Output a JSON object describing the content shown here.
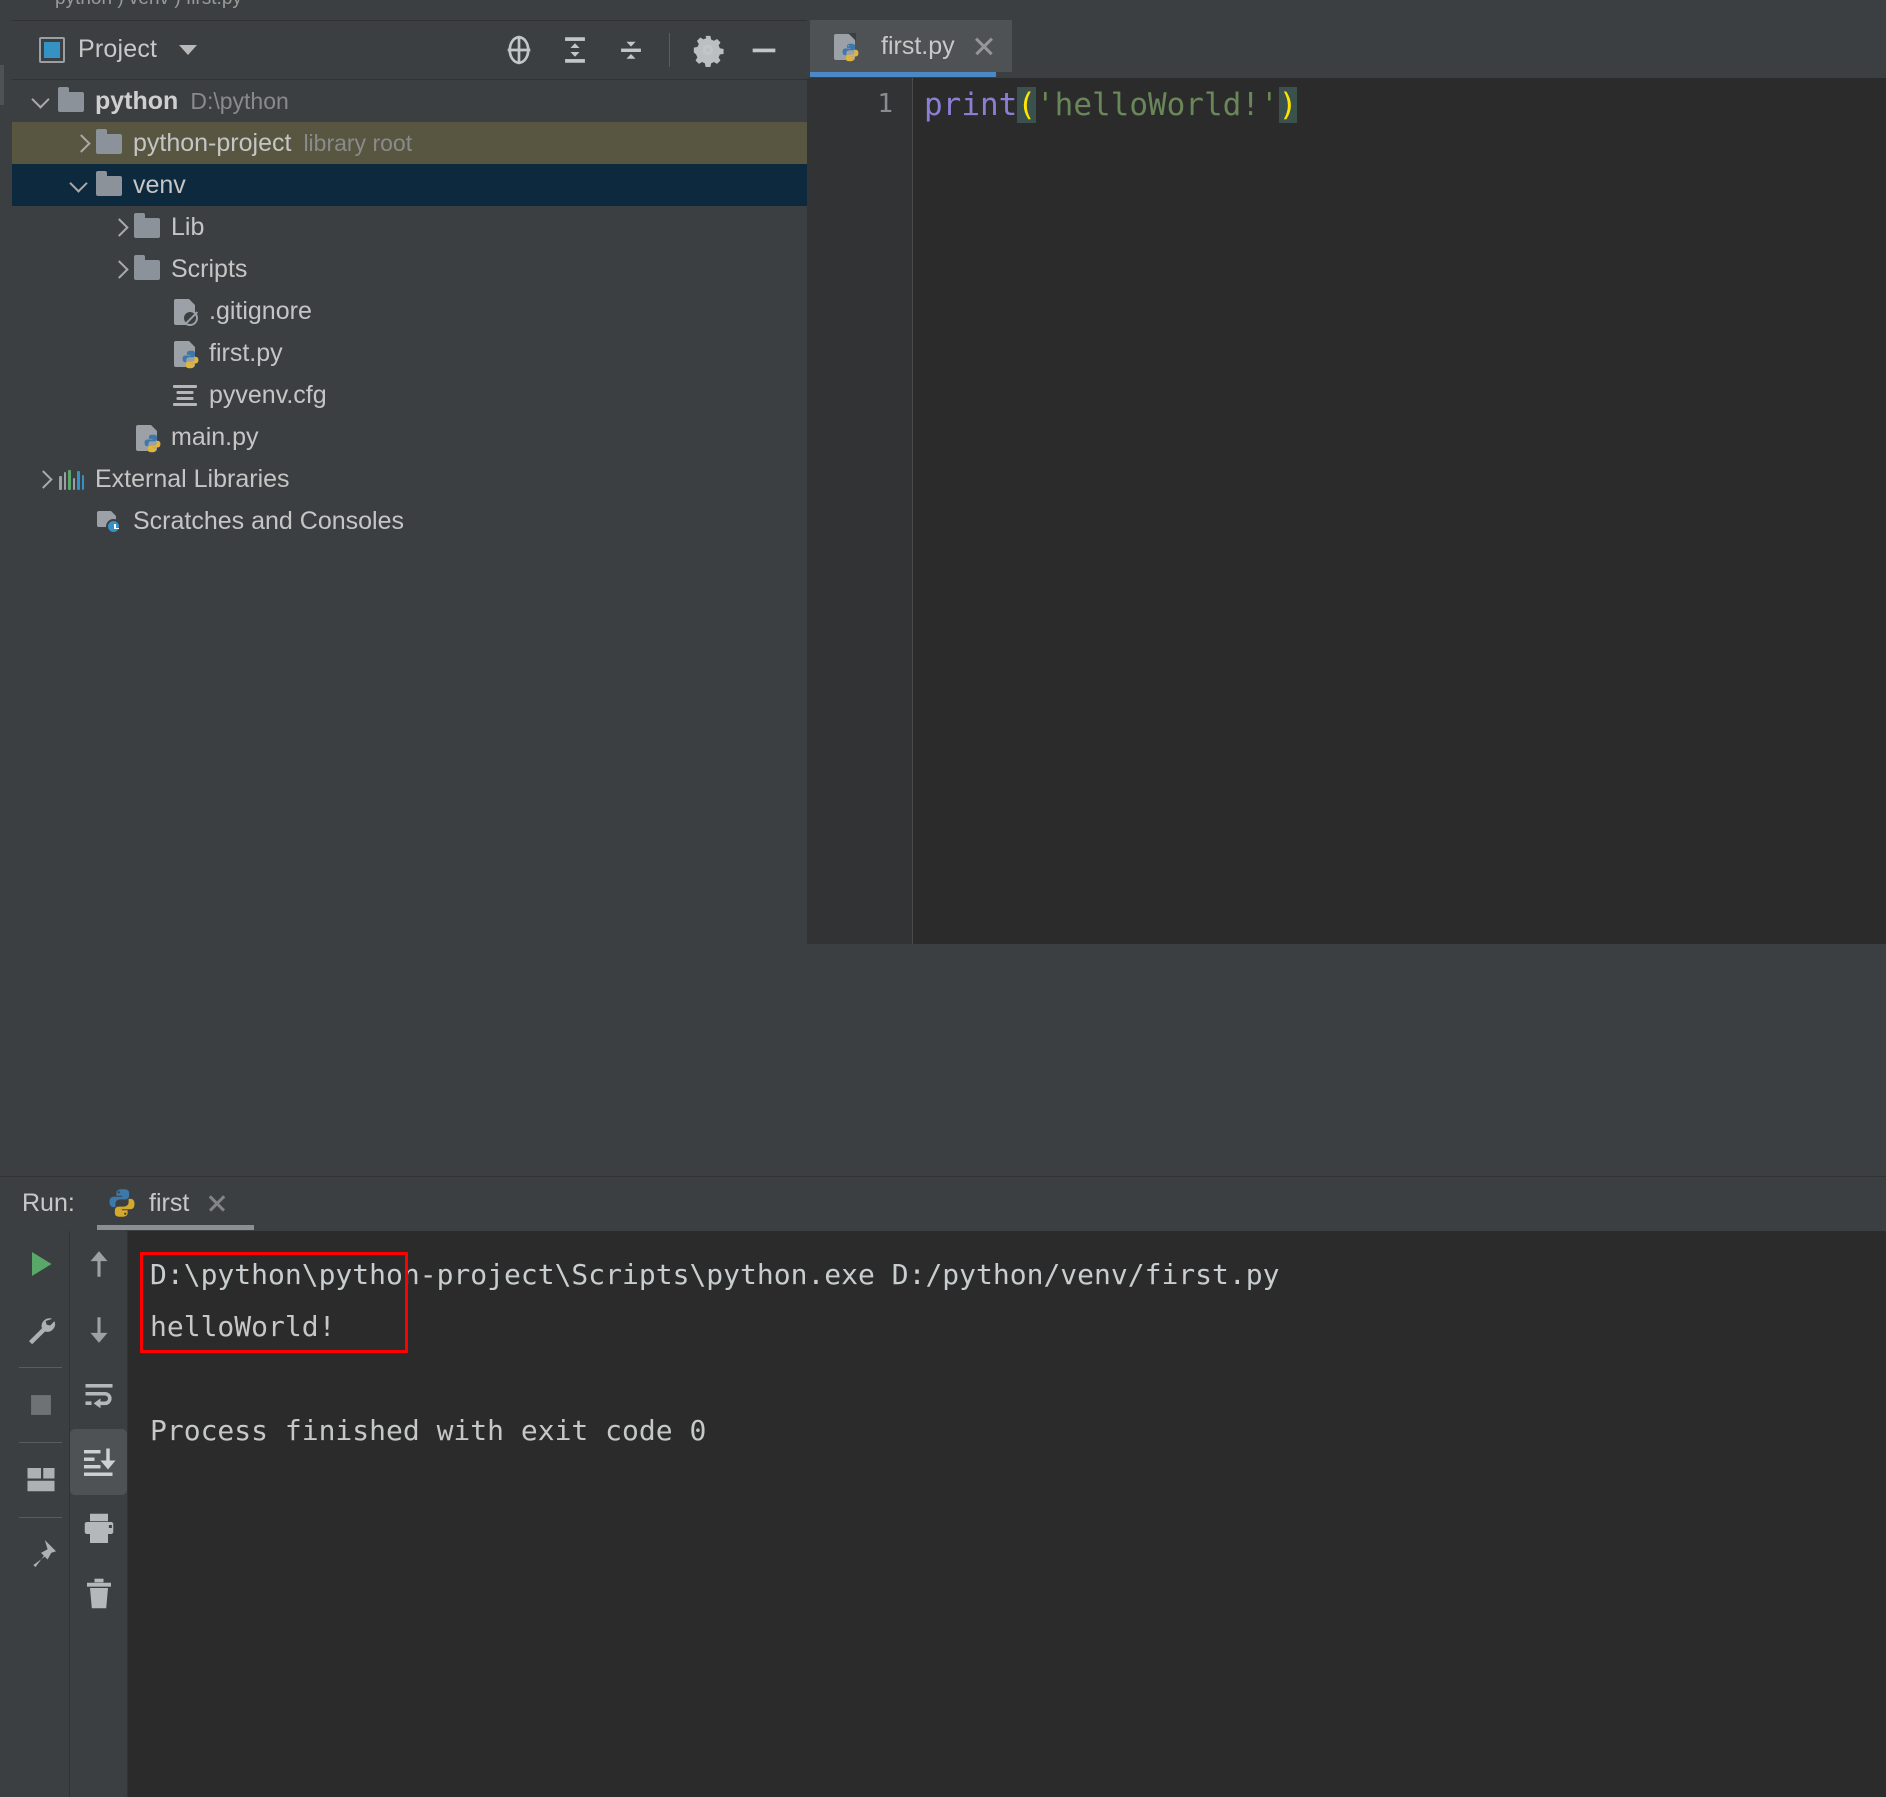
{
  "app": {
    "breadcrumb_sliver": "python ) venv ) first.py"
  },
  "project_panel": {
    "title": "Project",
    "window_icon": "project-window-icon",
    "dropdown_icon": "chevron-down-icon",
    "toolbar": [
      {
        "name": "locate-icon",
        "tooltip": "Select Opened File"
      },
      {
        "name": "expand-all-icon",
        "tooltip": "Expand All"
      },
      {
        "name": "collapse-all-icon",
        "tooltip": "Collapse All"
      },
      {
        "name": "gear-icon",
        "tooltip": "Settings"
      },
      {
        "name": "minimize-icon",
        "tooltip": "Hide"
      }
    ],
    "tree": [
      {
        "label": "python",
        "sub": "D:\\python",
        "icon": "folder-icon",
        "arrow": "open",
        "indent": 0,
        "bold": true,
        "state": "normal"
      },
      {
        "label": "python-project",
        "sub": "library root",
        "icon": "folder-icon",
        "arrow": "closed",
        "indent": 1,
        "bold": false,
        "state": "olive"
      },
      {
        "label": "venv",
        "sub": "",
        "icon": "folder-icon",
        "arrow": "open",
        "indent": 1,
        "bold": false,
        "state": "blue"
      },
      {
        "label": "Lib",
        "sub": "",
        "icon": "folder-icon",
        "arrow": "closed",
        "indent": 2,
        "bold": false,
        "state": "normal"
      },
      {
        "label": "Scripts",
        "sub": "",
        "icon": "folder-icon",
        "arrow": "closed",
        "indent": 2,
        "bold": false,
        "state": "normal"
      },
      {
        "label": ".gitignore",
        "sub": "",
        "icon": "gitignore-file-icon",
        "arrow": "none",
        "indent": 3,
        "bold": false,
        "state": "normal"
      },
      {
        "label": "first.py",
        "sub": "",
        "icon": "python-file-icon",
        "arrow": "none",
        "indent": 3,
        "bold": false,
        "state": "normal"
      },
      {
        "label": "pyvenv.cfg",
        "sub": "",
        "icon": "config-file-icon",
        "arrow": "none",
        "indent": 3,
        "bold": false,
        "state": "normal"
      },
      {
        "label": "main.py",
        "sub": "",
        "icon": "python-file-icon",
        "arrow": "none",
        "indent": 2,
        "bold": false,
        "state": "normal"
      },
      {
        "label": "External Libraries",
        "sub": "",
        "icon": "external-libraries-icon",
        "arrow": "closed",
        "indent": 0,
        "bold": false,
        "state": "normal"
      },
      {
        "label": "Scratches and Consoles",
        "sub": "",
        "icon": "scratches-icon",
        "arrow": "none",
        "indent": 1,
        "bold": false,
        "state": "normal"
      }
    ]
  },
  "editor": {
    "tab": {
      "label": "first.py",
      "icon": "python-file-icon",
      "close_icon": "close-icon",
      "active": true
    },
    "line_number": "1",
    "code": {
      "fn": "print",
      "open_paren": "(",
      "string": "'helloWorld!'",
      "close_paren": ")",
      "full": "print('helloWorld!')"
    }
  },
  "run_panel": {
    "label": "Run:",
    "tab": {
      "label": "first",
      "icon": "python-icon",
      "close_icon": "close-icon"
    },
    "left_toolbar": [
      {
        "name": "run-icon",
        "color": "#59a869"
      },
      {
        "name": "rerun-wrench-icon",
        "color": "#adb1b4"
      },
      {
        "name": "stop-icon",
        "color": "#6e7274"
      },
      {
        "name": "layout-icon",
        "color": "#adb1b4"
      },
      {
        "name": "pin-icon",
        "color": "#adb1b4"
      }
    ],
    "right_toolbar": [
      {
        "name": "up-arrow-icon",
        "active": false
      },
      {
        "name": "down-arrow-icon",
        "active": false
      },
      {
        "name": "soft-wrap-icon",
        "active": false
      },
      {
        "name": "scroll-to-end-icon",
        "active": true
      },
      {
        "name": "print-icon",
        "active": false
      },
      {
        "name": "trash-icon",
        "active": false
      }
    ],
    "console": [
      "D:\\python\\python-project\\Scripts\\python.exe D:/python/venv/first.py",
      "helloWorld!",
      "",
      "Process finished with exit code 0"
    ],
    "annotation": {
      "name": "red-highlight-box",
      "color": "#ff0000",
      "target": "helloWorld!"
    }
  },
  "colors": {
    "panel_bg": "#3c3f41",
    "editor_bg": "#2b2b2b",
    "selection_blue": "#0d293e",
    "selection_olive": "#585641",
    "tab_active": "#4e5254",
    "tab_underline": "#4a88c7",
    "accent_green": "#59a869",
    "string_green": "#6a8759",
    "keyword_purple": "#8a7fd4",
    "paren_yellow": "#ffe400",
    "annotation_red": "#ff0000"
  }
}
